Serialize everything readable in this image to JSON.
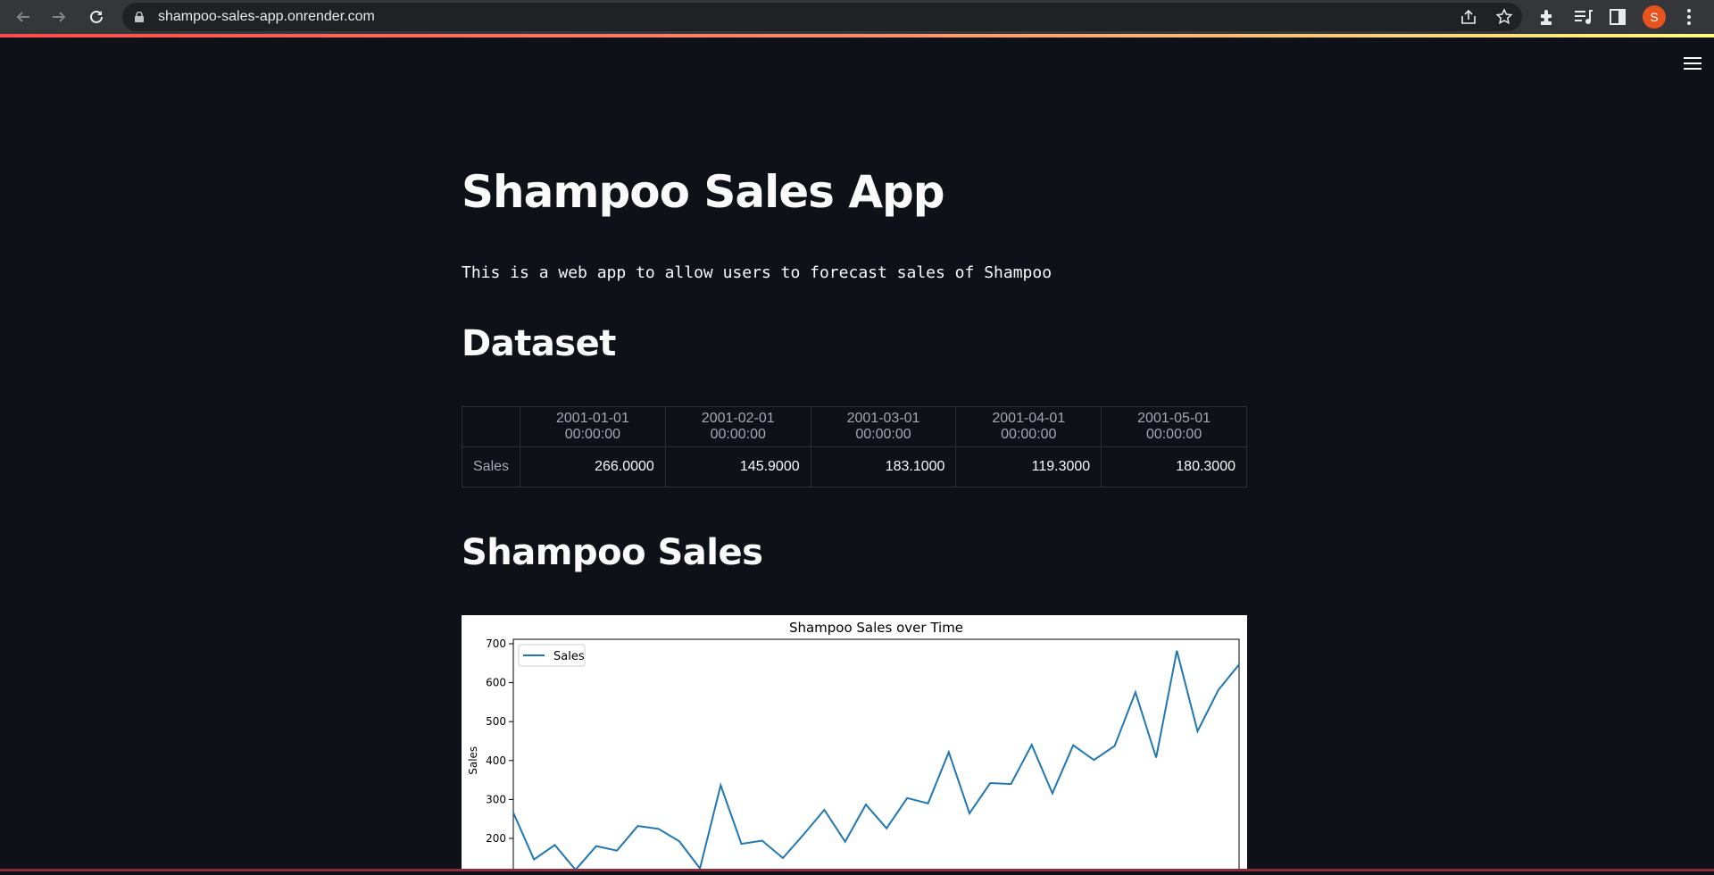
{
  "browser": {
    "url": "shampoo-sales-app.onrender.com",
    "avatar_letter": "S"
  },
  "app": {
    "title": "Shampoo Sales App",
    "description": "This is a web app to allow users to forecast sales of Shampoo",
    "dataset_heading": "Dataset",
    "chart_heading": "Shampoo Sales"
  },
  "table": {
    "columns": [
      "2001-01-01 00:00:00",
      "2001-02-01 00:00:00",
      "2001-03-01 00:00:00",
      "2001-04-01 00:00:00",
      "2001-05-01 00:00:00"
    ],
    "row_label": "Sales",
    "values": [
      "266.0000",
      "145.9000",
      "183.1000",
      "119.3000",
      "180.3000"
    ]
  },
  "colors": {
    "background": "#0e1117",
    "accent_gradient_start": "#ff4b4b",
    "accent_gradient_end": "#fffd80",
    "line": "#1f77b4"
  },
  "chart_data": {
    "type": "line",
    "title": "Shampoo Sales over Time",
    "ylabel": "Sales",
    "xlabel": "",
    "legend": "top-left",
    "series": [
      {
        "name": "Sales",
        "values": [
          266.0,
          145.9,
          183.1,
          119.3,
          180.3,
          168.5,
          231.8,
          224.5,
          192.8,
          122.9,
          336.5,
          185.9,
          194.3,
          149.5,
          210.1,
          273.3,
          191.4,
          287.0,
          226.0,
          303.6,
          289.9,
          421.6,
          264.5,
          342.3,
          339.7,
          440.4,
          315.9,
          439.3,
          401.3,
          437.4,
          575.5,
          407.6,
          682.0,
          475.3,
          581.3,
          646.9
        ]
      }
    ],
    "yticks": [
      200,
      300,
      400,
      500,
      600,
      700
    ]
  },
  "icons": [
    "back-arrow-icon",
    "forward-arrow-icon",
    "reload-icon",
    "lock-icon",
    "share-icon",
    "star-icon",
    "extensions-icon",
    "media-icon",
    "sidebar-icon",
    "menu-icon",
    "hamburger-icon"
  ]
}
